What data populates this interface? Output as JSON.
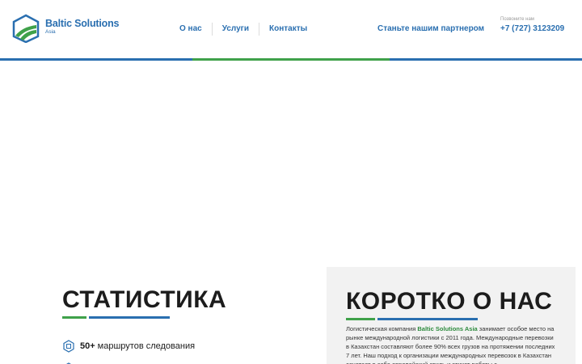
{
  "header": {
    "logo": {
      "name": "Baltic Solutions",
      "sub": "Asia",
      "colors": {
        "primary": "#2a6fb0",
        "accent": "#3fa14a"
      }
    },
    "nav": [
      {
        "label": "О нас"
      },
      {
        "label": "Услуги"
      },
      {
        "label": "Контакты"
      }
    ],
    "partner_link": "Станьте нашим партнером",
    "phone_label": "Позвоните нам",
    "phone": "+7 (727) 3123209"
  },
  "header_line_colors": [
    "#2a6fb0",
    "#3fa14a",
    "#2a6fb0"
  ],
  "stats": {
    "title": "СТАТИСТИКА",
    "items": [
      {
        "number": "50+",
        "text": "маршрутов следования",
        "icon": "route-hexagon-icon"
      }
    ]
  },
  "about": {
    "title": "КОРОТКО О НАС",
    "text_prefix": "Логистическая компания ",
    "company": "Baltic Solutions Asia",
    "text_suffix": " занимает особое место на рынке международной логистики с 2011 года. Международные перевозки в Казахстан составляют более 90% всех грузов на протяжении последних 7 лет. Наш подход к организации международных перевозок в Казахстан сочетает в себе европейский стиль и этикет работы с"
  },
  "colors": {
    "blue": "#2a6fb0",
    "green": "#3fa14a",
    "dark": "#1c1c1c",
    "panel": "#f2f2f2"
  }
}
